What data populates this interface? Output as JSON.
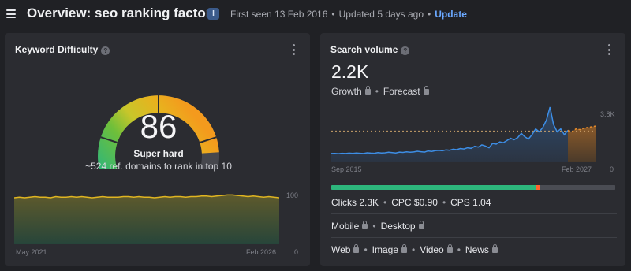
{
  "header": {
    "title": "Overview: seo ranking factors",
    "badge": "I",
    "first_seen": "First seen 13 Feb 2016",
    "updated": "Updated 5 days ago",
    "update_link": "Update"
  },
  "keyword_difficulty": {
    "title": "Keyword Difficulty",
    "help": "?",
    "value": "86",
    "label": "Super hard",
    "description": "~524 ref. domains to rank in top 10",
    "gauge_level": 86,
    "history": {
      "x_start_label": "May 2021",
      "x_end_label": "Feb 2026",
      "y_max_label": "100",
      "y_min_label": "0",
      "values": [
        82,
        83,
        82,
        83,
        84,
        83,
        83,
        82,
        84,
        83,
        83,
        84,
        83,
        84,
        83,
        82,
        83,
        84,
        83,
        83,
        83,
        84,
        84,
        83,
        84,
        83,
        83,
        82,
        83,
        84,
        83,
        84,
        84,
        83,
        84,
        84,
        85,
        85,
        84,
        85,
        86,
        87,
        87,
        86,
        85,
        84,
        85,
        84,
        83,
        84,
        83,
        82
      ]
    }
  },
  "search_volume": {
    "title": "Search volume",
    "help": "?",
    "value": "2.2K",
    "growth_label": "Growth",
    "forecast_label": "Forecast",
    "chart": {
      "x_start_label": "Sep 2015",
      "x_end_label": "Feb 2027",
      "y_max_label": "3.8K",
      "y_min_label": "0",
      "values": [
        600,
        610,
        590,
        620,
        600,
        630,
        610,
        640,
        620,
        600,
        650,
        630,
        620,
        660,
        640,
        650,
        690,
        670,
        640,
        700,
        680,
        720,
        690,
        710,
        760,
        730,
        700,
        780,
        750,
        800,
        820,
        790,
        860,
        830,
        900,
        870,
        950,
        920,
        1000,
        960,
        1100,
        1050,
        1200,
        1120,
        1000,
        1300,
        1250,
        1400,
        1350,
        1500,
        1650,
        1550,
        1700,
        2000,
        1750,
        1600,
        1900,
        2300,
        2100,
        2400,
        2900,
        3800,
        2600,
        2100,
        2300,
        1900,
        2200
      ],
      "forecast_values": [
        2200,
        2100,
        2300,
        2250,
        2350,
        2400,
        2450,
        2500
      ],
      "average": 2150
    },
    "intent_bar": {
      "segments": [
        {
          "share": 0.72,
          "color": "#2db67c"
        },
        {
          "share": 0.015,
          "color": "#ff642d"
        },
        {
          "share": 0.265,
          "color": "#4a4c53"
        }
      ]
    },
    "metrics": {
      "clicks": "Clicks 2.3K",
      "cpc": "CPC $0.90",
      "cps": "CPS 1.04"
    },
    "devices": {
      "mobile": "Mobile",
      "desktop": "Desktop"
    },
    "serp_types": {
      "web": "Web",
      "image": "Image",
      "video": "Video",
      "news": "News"
    }
  },
  "colors": {
    "accent_link": "#6aa8ff",
    "gauge_red": "#e0432f",
    "gauge_green": "#2db67c",
    "gauge_yellow": "#e8c12c",
    "gauge_orange": "#f4a21d",
    "kd_line": "#e0b521",
    "sv_line": "#3d8ee6",
    "forecast": "#e58a2a"
  }
}
